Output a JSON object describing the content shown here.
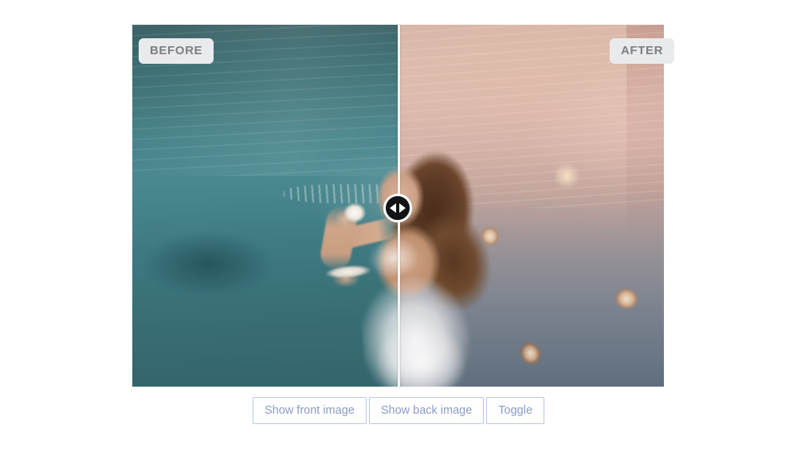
{
  "page": {
    "background_color": "#ffffff"
  },
  "comparison": {
    "name": "before-after-image-comparison-slider",
    "split_position_percent": 50,
    "before": {
      "label": "BEFORE",
      "description": "Underwater photo of a woman in a white dress sipping from a teacup, cool teal color grade",
      "tint_color": "#45808a"
    },
    "after": {
      "label": "AFTER",
      "description": "Same underwater photo with warm pink-sepia color grade and floating teacups",
      "tint_color": "#cfa89b"
    },
    "handle": {
      "icon_left": "triangle-left-icon",
      "icon_right": "triangle-right-icon",
      "fill_color": "#111314",
      "ring_color": "#ffffff"
    },
    "divider_color": "#f4f4f4",
    "label_style": {
      "background_color": "#e9eaec",
      "text_color": "#7c7f84"
    }
  },
  "controls": {
    "buttons": [
      {
        "label": "Show front image",
        "name": "show-front-image-button"
      },
      {
        "label": "Show back image",
        "name": "show-back-image-button"
      },
      {
        "label": "Toggle",
        "name": "toggle-button"
      }
    ],
    "border_color": "#b9c5e8",
    "text_color": "#8d9bc4"
  }
}
